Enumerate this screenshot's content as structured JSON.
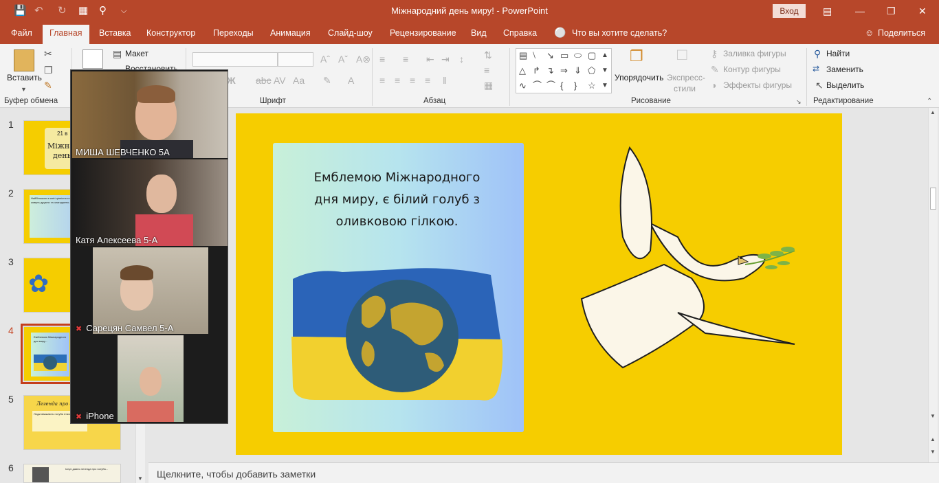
{
  "window": {
    "title": "Міжнародний день миру! - PowerPoint",
    "signin": "Вход"
  },
  "quick_access": {
    "save": "save-icon",
    "undo": "undo-icon",
    "redo": "redo-icon",
    "present": "present-icon",
    "preview": "print-preview-icon",
    "customize": "customize-icon"
  },
  "tabs": [
    "Файл",
    "Главная",
    "Вставка",
    "Конструктор",
    "Переходы",
    "Анимация",
    "Слайд-шоу",
    "Рецензирование",
    "Вид",
    "Справка"
  ],
  "tell_me": "Что вы хотите сделать?",
  "share": "Поделиться",
  "ribbon": {
    "clipboard": {
      "label": "Буфер обмена",
      "paste": "Вставить"
    },
    "slides": {
      "layout": "Макет",
      "reset": "Восстановить"
    },
    "font": {
      "label": "Шрифт"
    },
    "paragraph": {
      "label": "Абзац"
    },
    "drawing": {
      "label": "Рисование",
      "arrange": "Упорядочить",
      "quick_styles_1": "Экспресс-",
      "quick_styles_2": "стили",
      "fill": "Заливка фигуры",
      "outline": "Контур фигуры",
      "effects": "Эффекты фигуры"
    },
    "editing": {
      "label": "Редактирование",
      "find": "Найти",
      "replace": "Заменить",
      "select": "Выделить"
    }
  },
  "slides": [
    {
      "number": "1",
      "line1": "21 в",
      "line2": "Міжна",
      "line3": "день"
    },
    {
      "number": "2",
      "text": "Найбільшою в світі цінністю є мир, коли люди живуть дружно та злагоджено..."
    },
    {
      "number": "3"
    },
    {
      "number": "4",
      "active": true,
      "text": "Емблемою Міжнародного дня миру..."
    },
    {
      "number": "5",
      "title": "Легенда про сиз",
      "text": "Люди вважають голуба птахом миру..."
    },
    {
      "number": "6",
      "text": "Існує давня легенда про голуба..."
    }
  ],
  "main_slide": {
    "text": "Емблемою Міжнародного дня миру, є білий голуб з оливковою гілкою."
  },
  "participants": [
    {
      "name": "МИША ШЕВЧЕНКО 5А",
      "muted": false
    },
    {
      "name": "Катя Алексеева 5-А",
      "muted": false
    },
    {
      "name": "Сарецян Самвел 5-А",
      "muted": true
    },
    {
      "name": "iPhone",
      "muted": true
    }
  ],
  "notes": {
    "placeholder": "Щелкните, чтобы добавить заметки"
  },
  "colors": {
    "accent": "#b7472a",
    "slide_bg": "#f6cd00",
    "active_thumb": "#c43e1c"
  }
}
